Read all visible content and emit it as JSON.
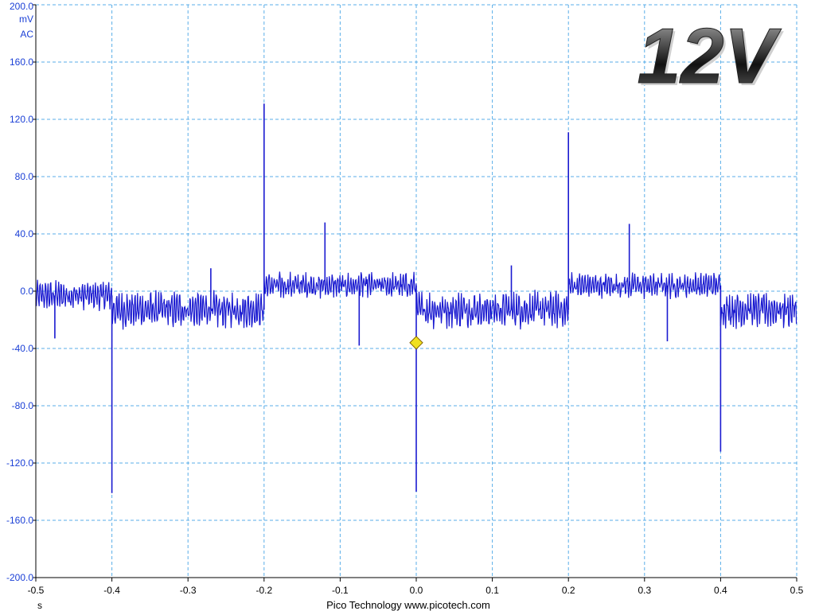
{
  "chart_data": {
    "type": "line",
    "title": "12V",
    "ylabel_unit": "mV",
    "ylabel_coupling": "AC",
    "xlabel": "s",
    "footer": "Pico Technology  www.picotech.com",
    "xlim": [
      -0.5,
      0.5
    ],
    "ylim": [
      -200,
      200
    ],
    "grid": true,
    "xticks": [
      "-0.5",
      "-0.4",
      "-0.3",
      "-0.2",
      "-0.1",
      "0.0",
      "0.1",
      "0.2",
      "0.3",
      "0.4",
      "0.5"
    ],
    "yticks": [
      "200.0",
      "160.0",
      "120.0",
      "80.0",
      "40.0",
      "0.0",
      "-40.0",
      "-80.0",
      "-120.0",
      "-160.0",
      "-200.0"
    ],
    "series": [
      {
        "color": "#1a1ad0",
        "noise_bands": [
          {
            "x_start": -0.5,
            "x_end": -0.4,
            "center": -3,
            "amplitude": 11
          },
          {
            "x_start": -0.4,
            "x_end": -0.2,
            "center": -13,
            "amplitude": 14
          },
          {
            "x_start": -0.2,
            "x_end": 0.0,
            "center": 4,
            "amplitude": 10
          },
          {
            "x_start": 0.0,
            "x_end": 0.2,
            "center": -13,
            "amplitude": 14
          },
          {
            "x_start": 0.2,
            "x_end": 0.4,
            "center": 4,
            "amplitude": 10
          },
          {
            "x_start": 0.4,
            "x_end": 0.5,
            "center": -13,
            "amplitude": 14
          }
        ],
        "spikes": [
          {
            "x": -0.4,
            "y": -141
          },
          {
            "x": -0.2,
            "y": 131
          },
          {
            "x": -0.12,
            "y": 48
          },
          {
            "x": -0.075,
            "y": -38
          },
          {
            "x": 0.0,
            "y": -140
          },
          {
            "x": 0.2,
            "y": 111
          },
          {
            "x": 0.28,
            "y": 47
          },
          {
            "x": 0.33,
            "y": -35
          },
          {
            "x": 0.4,
            "y": -112
          },
          {
            "x": -0.475,
            "y": -33
          },
          {
            "x": -0.27,
            "y": 16
          },
          {
            "x": 0.125,
            "y": 18
          }
        ]
      }
    ],
    "trigger_marker": {
      "x": 0.0,
      "y": -36,
      "color": "#f0e020"
    }
  }
}
